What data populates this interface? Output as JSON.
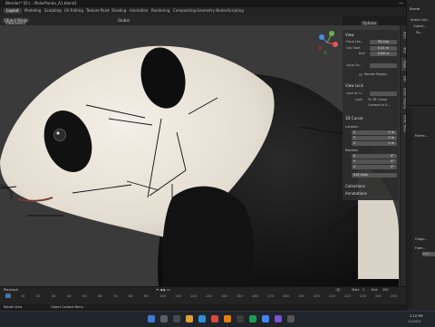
{
  "window": {
    "title": "Blender* [D:\\...\\PolarPanda_A1.blend]",
    "controls": [
      "—",
      "□",
      "✕"
    ]
  },
  "workspaces": [
    "Layout",
    "Modeling",
    "Sculpting",
    "UV Editing",
    "Texture Paint",
    "Shading",
    "Animation",
    "Rendering",
    "Compositing",
    "Geometry Nodes",
    "Scripting"
  ],
  "active_workspace": "Layout",
  "header3d": {
    "mode": "Object Mode",
    "menus": [
      "View",
      "Select",
      "Add",
      "Object"
    ],
    "orientation": "Global",
    "options": "Options"
  },
  "npanel": {
    "tabs": [
      "Item",
      "Tool",
      "View",
      "Edit",
      "OCAC Forums",
      "OCAC Tools"
    ],
    "view": {
      "title": "View",
      "focal_length": {
        "label": "Focal Len...",
        "value": "50 mm"
      },
      "clip_start": {
        "label": "Clip Start",
        "value": "0.01 m"
      },
      "clip_end": {
        "label": "End",
        "value": "1000 m"
      },
      "local_camera": {
        "label": "Local Ca...",
        "value": ""
      },
      "render_region": "Render Region"
    },
    "view_lock": {
      "title": "View Lock",
      "lock_to_object": "Lock to O...",
      "lock": "Lock",
      "to_3d_cursor": "To 3D Cursor",
      "camera_to_view": "Camera to V..."
    },
    "cursor3d": {
      "title": "3D Cursor",
      "location": "Location",
      "loc": [
        {
          "axis": "X",
          "value": "0 m"
        },
        {
          "axis": "Y",
          "value": "0 m"
        },
        {
          "axis": "Z",
          "value": "0 m"
        }
      ],
      "rotation": "Rotation",
      "rot": [
        {
          "axis": "X",
          "value": "0°"
        },
        {
          "axis": "Y",
          "value": "0°"
        },
        {
          "axis": "Z",
          "value": "0°"
        }
      ],
      "rotation_mode": "XYZ Euler"
    },
    "collections": "Collections",
    "annotations": "Annotations"
  },
  "outliner": {
    "title": "Scene",
    "items": [
      "Scene Coll...",
      "Collect...",
      "Pa..."
    ]
  },
  "properties": {
    "labels": [
      "Forma...",
      "Outpu...",
      "Fram..."
    ],
    "field": "Inver"
  },
  "timeline": {
    "frame_ticks": [
      "0",
      "10",
      "20",
      "30",
      "40",
      "50",
      "60",
      "70",
      "80",
      "90",
      "100",
      "110",
      "120",
      "130",
      "140",
      "150",
      "160",
      "170",
      "180",
      "190",
      "200",
      "210",
      "220",
      "230",
      "240",
      "250"
    ],
    "current_frame": "1",
    "start_label": "Start",
    "start_value": "1",
    "end_label": "End",
    "end_value": "250",
    "menus": [
      "Playback",
      "Keying",
      "View",
      "Marker"
    ]
  },
  "statusbar": {
    "left": "Rotate View",
    "mid": "Object Context Menu"
  },
  "taskbar": {
    "time": "2:10 PM",
    "date": "1/1/2024"
  },
  "colors": {
    "accent": "#4772b3",
    "viewport_bg": "#3a3a3a",
    "panel_bg": "#2c2c2c",
    "panda_white": "#ece6dc",
    "panda_black": "#141414"
  }
}
